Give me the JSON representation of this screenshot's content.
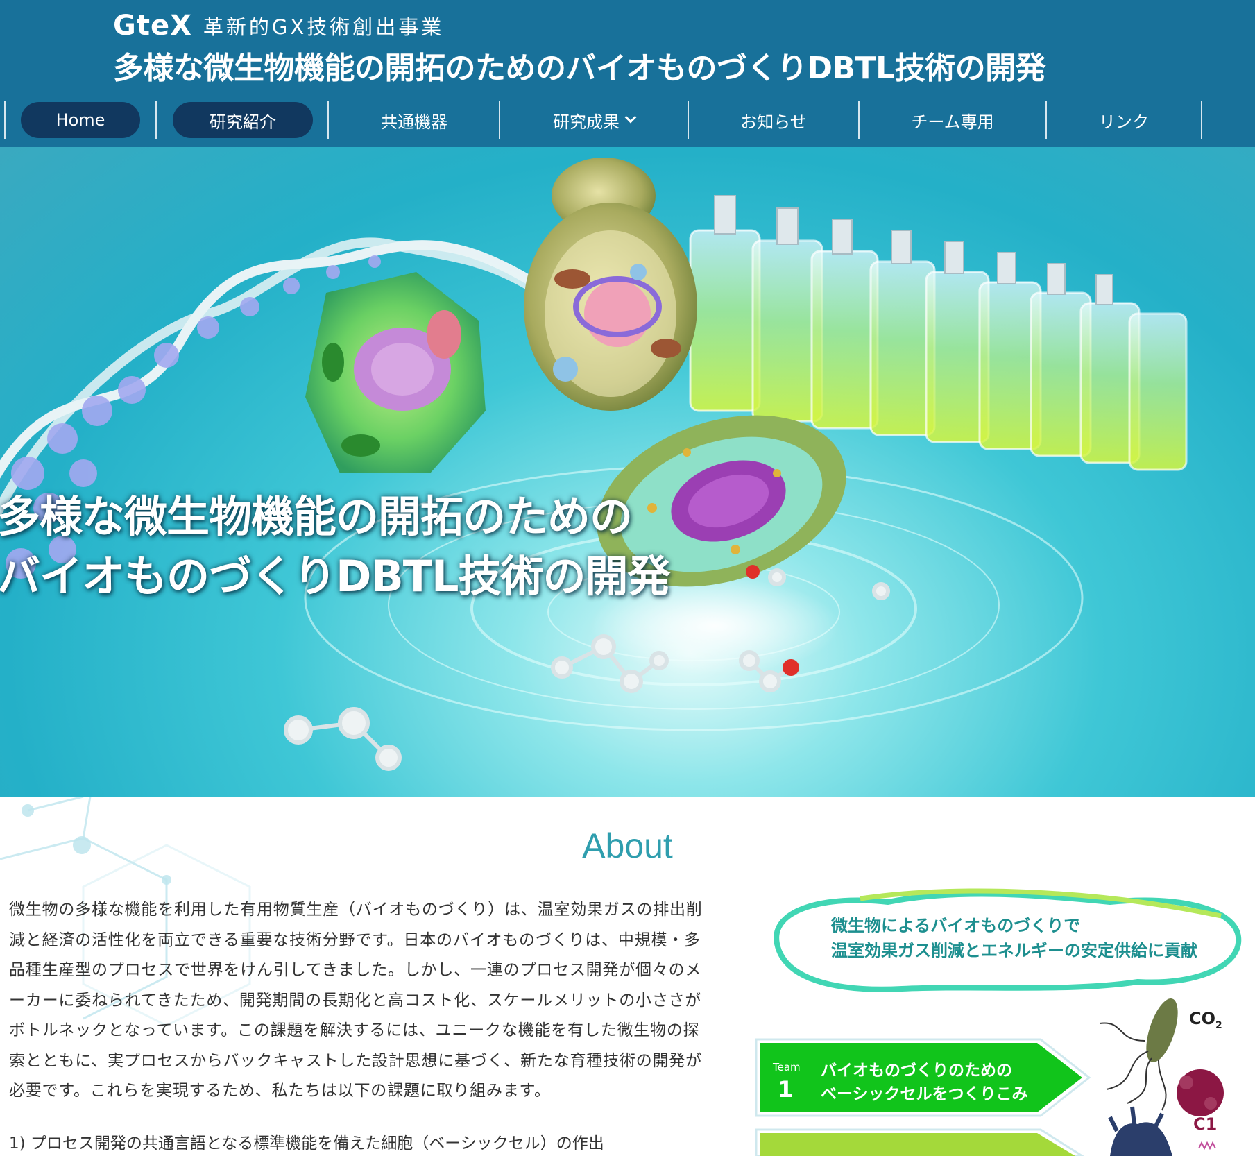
{
  "header": {
    "logo": "GteX",
    "tagline": "革新的GX技術創出事業",
    "title": "多様な微生物機能の開拓のためのバイオものづくりDBTL技術の開発"
  },
  "nav": {
    "items": [
      {
        "label": "Home"
      },
      {
        "label": "研究紹介"
      },
      {
        "label": "共通機器"
      },
      {
        "label": "研究成果"
      },
      {
        "label": "お知らせ"
      },
      {
        "label": "チーム専用"
      },
      {
        "label": "リンク"
      }
    ],
    "dropdown_icon": "chevron-down-icon"
  },
  "hero": {
    "line1": "多様な微生物機能の開拓のための",
    "line2": "バイオものづくりDBTL技術の開発"
  },
  "about": {
    "title": "About",
    "body_lines": [
      "微生物の多様な機能を利用した有用物質生産（バイオものづくり）は、温室効果ガスの排出削",
      "減と経済の活性化を両立できる重要な技術分野です。日本のバイオものづくりは、中規模・多",
      "品種生産型のプロセスで世界をけん引してきました。しかし、一連のプロセス開発が個々のメ",
      "ーカーに委ねられてきたため、開発期間の長期化と高コスト化、スケールメリットの小ささが",
      "ボトルネックとなっています。この課題を解決するには、ユニークな機能を有した微生物の探",
      "索とともに、実プロセスからバックキャストした設計思想に基づく、新たな育種技術の開発が",
      "必要です。これらを実現するため、私たちは以下の課題に取り組みます。"
    ],
    "list_item_1": "1) プロセス開発の共通言語となる標準機能を備えた細胞（ベーシックセル）の作出"
  },
  "figure": {
    "cloud_line1": "微生物によるバイオものづくりで",
    "cloud_line2": "温室効果ガス削減とエネルギーの安定供給に貢献",
    "team_label": "Team",
    "team_number": "1",
    "team_line1": "バイオものづくりのための",
    "team_line2": "ベーシックセルをつくりこみ",
    "co2": "CO",
    "co2_sub": "2",
    "c1": "C1"
  },
  "colors": {
    "header_bg": "#18719a",
    "nav_active": "#11385f",
    "about_title": "#2f9eae",
    "team_green": "#11c41b"
  }
}
